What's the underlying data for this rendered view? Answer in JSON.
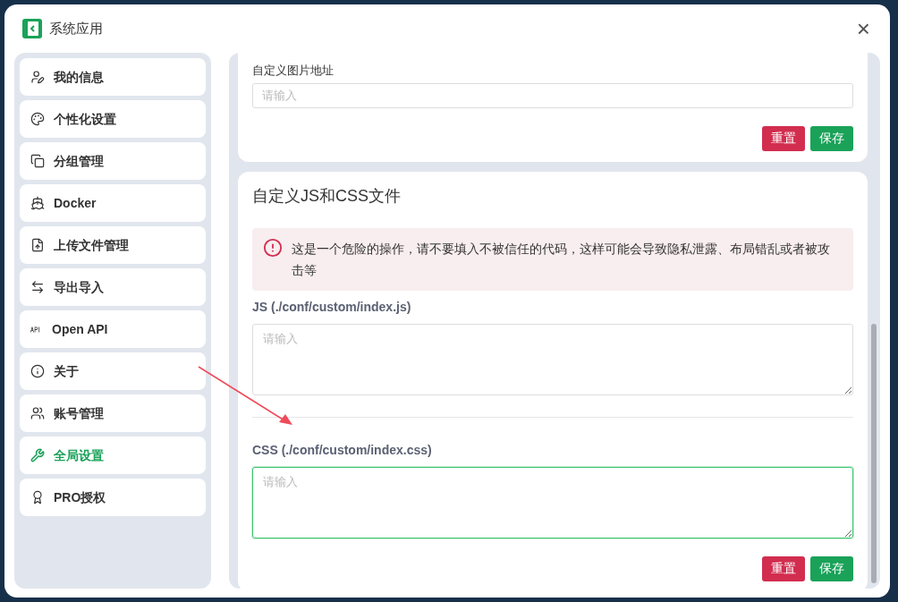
{
  "window": {
    "title": "系统应用",
    "close": "×"
  },
  "sidebar": {
    "items": [
      {
        "label": "我的信息",
        "selected": false
      },
      {
        "label": "个性化设置",
        "selected": false
      },
      {
        "label": "分组管理",
        "selected": false
      },
      {
        "label": "Docker",
        "selected": false
      },
      {
        "label": "上传文件管理",
        "selected": false
      },
      {
        "label": "导出导入",
        "selected": false
      },
      {
        "label": "Open API",
        "selected": false
      },
      {
        "label": "关于",
        "selected": false
      },
      {
        "label": "账号管理",
        "selected": false
      },
      {
        "label": "全局设置",
        "selected": true
      },
      {
        "label": "PRO授权",
        "selected": false
      }
    ]
  },
  "image_card": {
    "label": "自定义图片地址",
    "field": {
      "placeholder": "请输入"
    },
    "buttons": [
      {
        "label": "重置",
        "kind": "danger"
      },
      {
        "label": "保存",
        "kind": "primary"
      }
    ]
  },
  "custom_card": {
    "title": "自定义JS和CSS文件",
    "alert": "这是一个危险的操作，请不要填入不被信任的代码，这样可能会导致隐私泄露、布局错乱或者被攻击等",
    "fields": [
      {
        "label": "JS (./conf/custom/index.js)",
        "placeholder": "请输入",
        "focused": false
      },
      {
        "label": "CSS (./conf/custom/index.css)",
        "placeholder": "请输入",
        "focused": true
      }
    ],
    "buttons": [
      {
        "label": "重置",
        "kind": "danger"
      },
      {
        "label": "保存",
        "kind": "primary"
      }
    ]
  }
}
